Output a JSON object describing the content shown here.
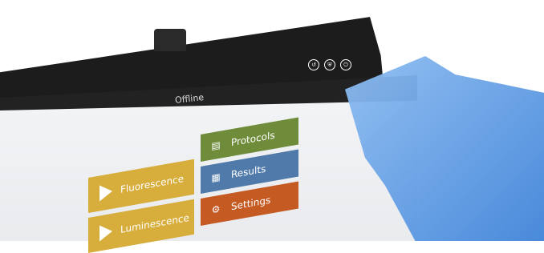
{
  "top_bar": {
    "title": "Offline",
    "icons": [
      "back-icon",
      "shield-icon",
      "power-icon"
    ]
  },
  "tiles": {
    "fluorescence": {
      "label": "Fluorescence",
      "icon": "play-icon",
      "color": "#d7ad3b"
    },
    "luminescence": {
      "label": "Luminescence",
      "icon": "play-icon",
      "color": "#d7ad3b"
    },
    "protocols": {
      "label": "Protocols",
      "icon": "clipboard-icon",
      "color": "#6f8c3a"
    },
    "results": {
      "label": "Results",
      "icon": "results-icon",
      "color": "#4f7aa9"
    },
    "settings": {
      "label": "Settings",
      "icon": "gear-icon",
      "color": "#c55a23"
    }
  }
}
